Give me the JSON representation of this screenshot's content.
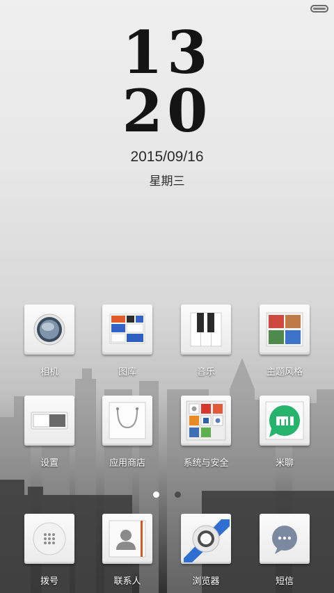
{
  "status_bar": {
    "battery_icon": "battery-icon"
  },
  "clock": {
    "hour": "13",
    "minute": "20",
    "date": "2015/09/16",
    "weekday": "星期三"
  },
  "apps_row1": [
    {
      "label": "相机",
      "icon": "camera-icon"
    },
    {
      "label": "图库",
      "icon": "gallery-icon"
    },
    {
      "label": "音乐",
      "icon": "music-icon"
    },
    {
      "label": "主题风格",
      "icon": "theme-icon"
    }
  ],
  "apps_row2": [
    {
      "label": "设置",
      "icon": "settings-icon"
    },
    {
      "label": "应用商店",
      "icon": "app-store-icon"
    },
    {
      "label": "系统与安全",
      "icon": "system-security-folder-icon"
    },
    {
      "label": "米聊",
      "icon": "miliao-icon",
      "badge_text": "mi"
    }
  ],
  "page_indicator": {
    "current_page": 1,
    "page_count": 2
  },
  "dock": [
    {
      "label": "拨号",
      "icon": "dialer-icon"
    },
    {
      "label": "联系人",
      "icon": "contacts-icon"
    },
    {
      "label": "浏览器",
      "icon": "browser-icon"
    },
    {
      "label": "短信",
      "icon": "messages-icon"
    }
  ],
  "colors": {
    "label_text": "#ffffff",
    "clock_text": "#141414",
    "accent_blue": "#2f6fd1",
    "accent_orange": "#d9561e"
  }
}
